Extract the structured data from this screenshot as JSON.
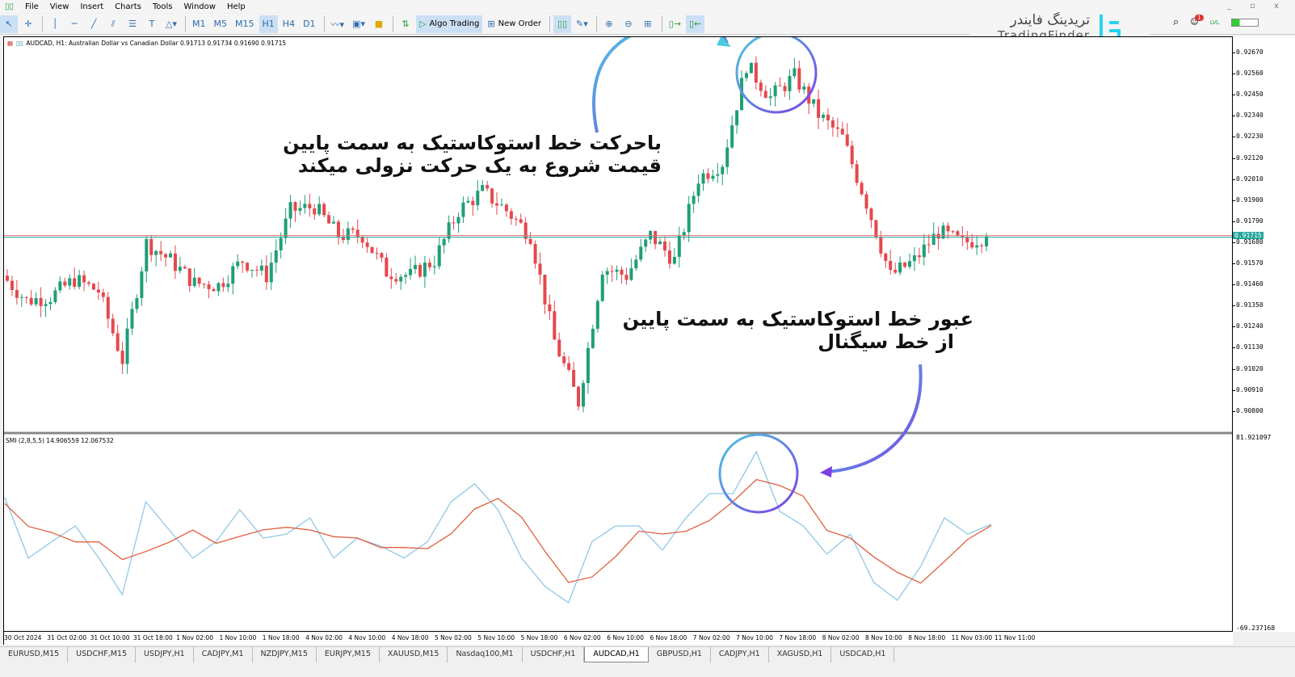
{
  "menu": [
    "File",
    "View",
    "Insert",
    "Charts",
    "Tools",
    "Window",
    "Help"
  ],
  "toolbar": {
    "timeframes": [
      "M1",
      "M5",
      "M15",
      "H1",
      "H4",
      "D1"
    ],
    "active_timeframe": "H1",
    "algo_trading": "Algo Trading",
    "new_order": "New Order"
  },
  "logo": {
    "fa": "تریدینگ فایندر",
    "en": "TradingFinder"
  },
  "notifications_badge": "1",
  "level_label": "LVL",
  "chart_header": "AUDCAD, H1:  Australian Dollar vs Canadian Dollar  0.91713 0.91734 0.91690 0.91715",
  "indicator_header": "SMI (2,8,5,5) 14.906559 12.067532",
  "colors": {
    "bull": "#1f9e78",
    "bear": "#e5484d",
    "smi_main": "#8ec8e6",
    "smi_signal": "#e06040",
    "bid_line": "#e57373",
    "ask_line": "#26a69a",
    "arrow_purple": "#7b3fe4",
    "arrow_teal": "#4cc9e0"
  },
  "chart_data": [
    {
      "type": "candlestick",
      "symbol": "AUDCAD",
      "timeframe": "H1",
      "ylim": [
        0.9075,
        0.9272
      ],
      "y_ticks": [
        "0.92670",
        "0.92560",
        "0.92450",
        "0.92340",
        "0.92230",
        "0.92120",
        "0.92010",
        "0.91900",
        "0.91790",
        "0.91680",
        "0.91570",
        "0.91460",
        "0.91350",
        "0.91240",
        "0.91130",
        "0.91020",
        "0.90910",
        "0.90800"
      ],
      "current_price": "0.91715",
      "approx_closes": [
        0.9151,
        0.9138,
        0.914,
        0.9149,
        0.9143,
        0.9107,
        0.9168,
        0.9159,
        0.9147,
        0.9146,
        0.9159,
        0.9151,
        0.9185,
        0.9187,
        0.9172,
        0.9172,
        0.9153,
        0.9151,
        0.9159,
        0.9185,
        0.9195,
        0.9185,
        0.9172,
        0.9117,
        0.9085,
        0.9155,
        0.9151,
        0.9172,
        0.9159,
        0.9202,
        0.921,
        0.9261,
        0.9244,
        0.9255,
        0.9235,
        0.9223,
        0.9189,
        0.9151,
        0.9159,
        0.9174,
        0.9168,
        0.91715
      ]
    },
    {
      "type": "line",
      "name": "SMI (2,8,5,5)",
      "ylim": [
        -69.237168,
        81.921097
      ],
      "y_ticks": [
        "81.921097",
        "-69.237168"
      ],
      "main": [
        34.7,
        -13.1,
        0,
        12.4,
        -13,
        -41.8,
        31.5,
        9.2,
        -13,
        0,
        25.2,
        2.8,
        6,
        18.8,
        -13,
        2.8,
        -3.5,
        -13,
        0,
        31.5,
        45.6,
        25.2,
        -13,
        -35.4,
        -48.2,
        0,
        12.4,
        12.4,
        -6.7,
        18.8,
        37.9,
        37.9,
        71.1,
        23.9,
        12.4,
        -9.9,
        6,
        -32.2,
        -46.3,
        -19.5,
        18.8,
        6,
        13.7
      ],
      "signal": [
        30,
        12,
        7.2,
        -0.2,
        -0.2,
        -14.1,
        -7.8,
        -0.4,
        9.2,
        -1.3,
        4.1,
        9.3,
        11.3,
        9.2,
        3.9,
        2.9,
        -4.6,
        -4.6,
        -5.5,
        6.2,
        25.7,
        34.1,
        19.3,
        -7.7,
        -32.2,
        -27.9,
        -11.9,
        8.3,
        6,
        8.2,
        16.7,
        31.5,
        49,
        44.3,
        35.8,
        8.8,
        2.8,
        -12,
        -24.2,
        -32.7,
        -15.7,
        1.8,
        12.8
      ]
    }
  ],
  "time_labels": [
    "30 Oct 2024",
    "31 Oct 02:00",
    "31 Oct 10:00",
    "31 Oct 18:00",
    "1 Nov 02:00",
    "1 Nov 10:00",
    "1 Nov 18:00",
    "4 Nov 02:00",
    "4 Nov 10:00",
    "4 Nov 18:00",
    "5 Nov 02:00",
    "5 Nov 10:00",
    "5 Nov 18:00",
    "6 Nov 02:00",
    "6 Nov 10:00",
    "6 Nov 18:00",
    "7 Nov 02:00",
    "7 Nov 10:00",
    "7 Nov 18:00",
    "8 Nov 02:00",
    "8 Nov 10:00",
    "8 Nov 18:00",
    "11 Nov 03:00",
    "11 Nov 11:00"
  ],
  "annotations": {
    "top": [
      "باحرکت خط استوکاستیک به سمت پایین",
      "قیمت شروع به یک حرکت نزولی میکند"
    ],
    "bottom": [
      "عبور خط استوکاستیک به سمت پایین",
      "از خط سیگنال"
    ]
  },
  "tabs": [
    "EURUSD,M15",
    "USDCHF,M15",
    "USDJPY,H1",
    "CADJPY,M1",
    "NZDJPY,M15",
    "EURJPY,M15",
    "XAUUSD,M15",
    "Nasdaq100,M1",
    "USDCHF,H1",
    "AUDCAD,H1",
    "GBPUSD,H1",
    "CADJPY,H1",
    "XAGUSD,H1",
    "USDCAD,H1"
  ],
  "active_tab": "AUDCAD,H1"
}
